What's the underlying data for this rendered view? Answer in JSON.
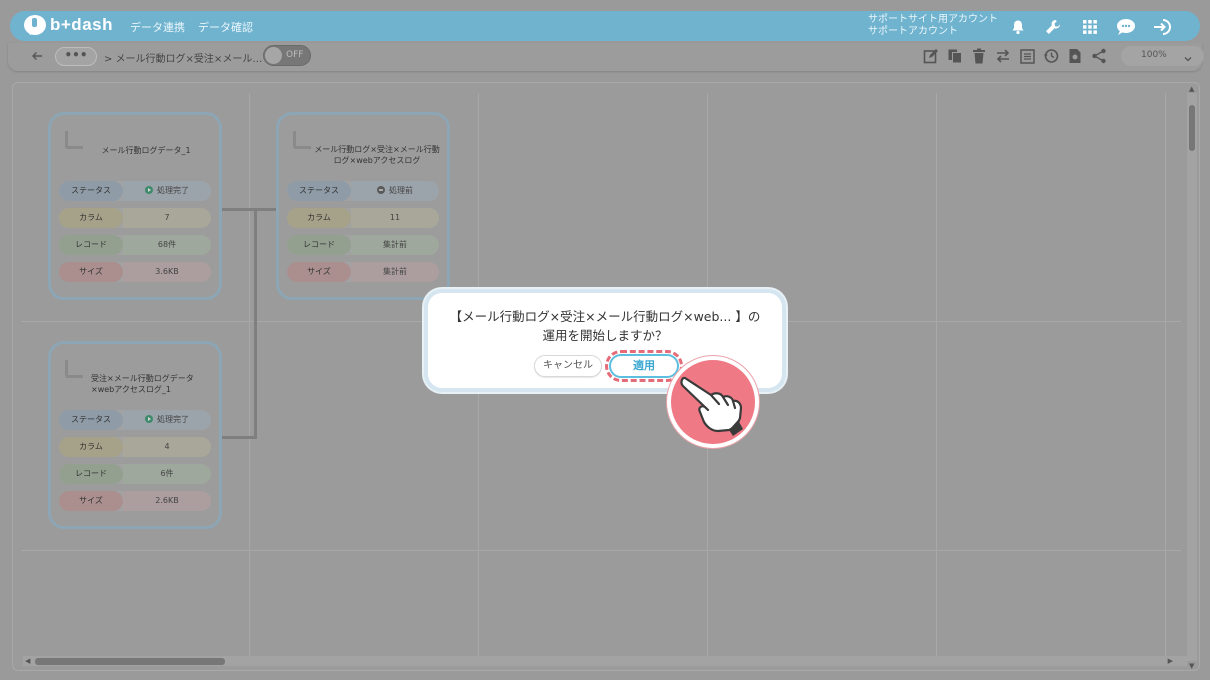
{
  "app": {
    "logo_text": "b+dash",
    "nav": [
      "データ連携",
      "データ確認"
    ],
    "support_line1": "サポートサイト用アカウント",
    "support_line2": "サポートアカウント",
    "header_icons": [
      "bell-icon",
      "wrench-icon",
      "grid-icon",
      "chat-icon",
      "logout-icon"
    ]
  },
  "toolbar": {
    "breadcrumb_more": "•••",
    "breadcrumb": "> メール行動ログ×受注×メール…",
    "toggle_label": "OFF",
    "icons": [
      "edit-icon",
      "copy-icon",
      "trash-icon",
      "swap-icon",
      "list-icon",
      "history-icon",
      "export-icon",
      "share-icon"
    ],
    "zoom": "100%"
  },
  "nodes": [
    {
      "title": "メール行動ログデータ_1",
      "rows": [
        {
          "label": "ステータス",
          "value": "処理完了",
          "status": "done"
        },
        {
          "label": "カラム",
          "value": "7"
        },
        {
          "label": "レコード",
          "value": "68件"
        },
        {
          "label": "サイズ",
          "value": "3.6KB"
        }
      ]
    },
    {
      "title": "受注×メール行動ログデータ×webアクセスログ_1",
      "rows": [
        {
          "label": "ステータス",
          "value": "処理完了",
          "status": "done"
        },
        {
          "label": "カラム",
          "value": "4"
        },
        {
          "label": "レコード",
          "value": "6件"
        },
        {
          "label": "サイズ",
          "value": "2.6KB"
        }
      ]
    },
    {
      "title": "メール行動ログ×受注×メール行動ログ×webアクセスログ",
      "rows": [
        {
          "label": "ステータス",
          "value": "処理前",
          "status": "pending"
        },
        {
          "label": "カラム",
          "value": "11"
        },
        {
          "label": "レコード",
          "value": "集計前"
        },
        {
          "label": "サイズ",
          "value": "集計前"
        }
      ]
    }
  ],
  "dialog": {
    "message_line1": "【メール行動ログ×受注×メール行動ログ×web... 】の",
    "message_line2": "運用を開始しますか？",
    "cancel_label": "キャンセル",
    "apply_label": "適用"
  },
  "colors": {
    "header": "#6fb3cf",
    "apply_border": "#5cbfe0",
    "highlight": "#e56b78",
    "hand_bg": "#ef7a86"
  }
}
